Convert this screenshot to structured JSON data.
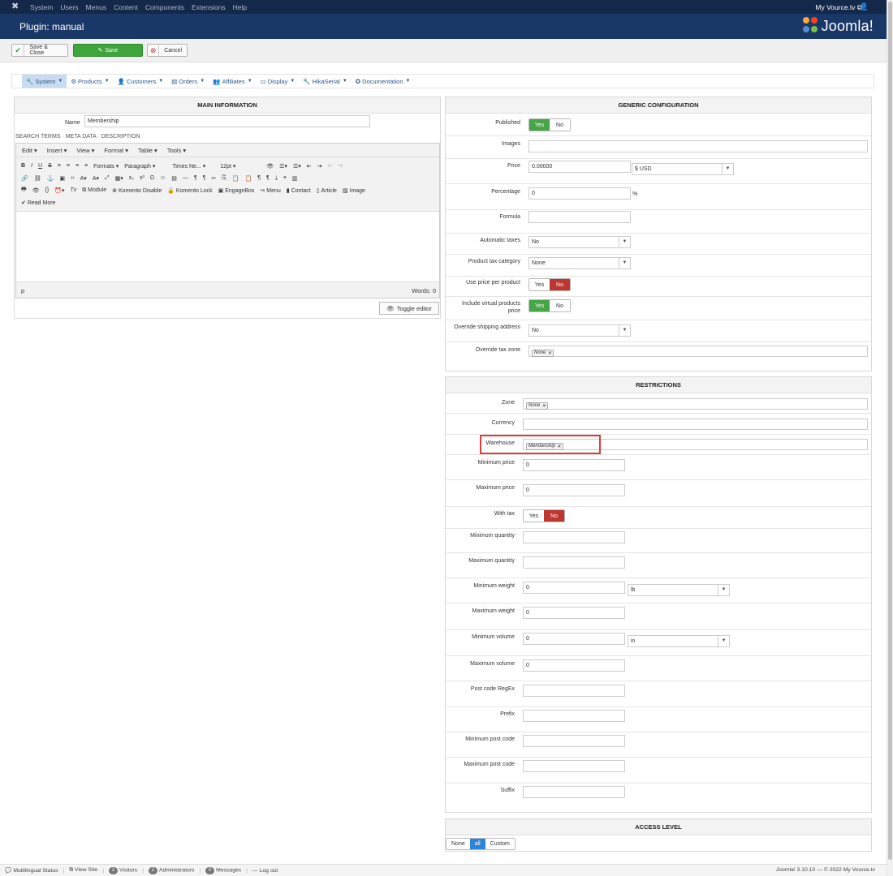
{
  "topbar": {
    "menu": [
      "System",
      "Users",
      "Menus",
      "Content",
      "Components",
      "Extensions",
      "Help"
    ],
    "site_link": "My Vource.tv"
  },
  "header": {
    "title": "Plugin: manual",
    "brand": "Joomla!"
  },
  "toolbar": {
    "save_close": "Save & Close",
    "save": "Save",
    "cancel": "Cancel"
  },
  "nav": [
    {
      "label": "System",
      "icon": "wrench-icon"
    },
    {
      "label": "Products",
      "icon": "products-icon"
    },
    {
      "label": "Customers",
      "icon": "user-icon"
    },
    {
      "label": "Orders",
      "icon": "orders-icon"
    },
    {
      "label": "Affiliates",
      "icon": "affiliates-icon"
    },
    {
      "label": "Display",
      "icon": "monitor-icon"
    },
    {
      "label": "HikaSerial",
      "icon": "wrench-icon"
    },
    {
      "label": "Documentation",
      "icon": "help-icon"
    }
  ],
  "main": {
    "header": "MAIN INFORMATION",
    "name_label": "Name",
    "name_value": "Membership",
    "subtabs": "SEARCH TERMS · META DATA · DESCRIPTION",
    "editor_menu": [
      "Edit",
      "Insert",
      "View",
      "Format",
      "Table",
      "Tools"
    ],
    "formats": "Formats",
    "paragraph": "Paragraph",
    "font": "Times Ne...",
    "size": "12pt",
    "buttons": [
      "Module",
      "Komento Disable",
      "Komento Lock",
      "EngageBox",
      "Menu",
      "Contact",
      "Article",
      "Image"
    ],
    "read_more": "Read More",
    "status_p": "p",
    "words": "Words: 0",
    "toggle": "Toggle editor"
  },
  "generic": {
    "header": "GENERIC CONFIGURATION",
    "published": "Published",
    "images": "Images",
    "price": "Price",
    "price_value": "0.00000",
    "currency_value": "$ USD",
    "percentage": "Percentage",
    "percentage_value": "0",
    "percent_sign": "%",
    "formula": "Formula",
    "auto_taxes": "Automatic taxes",
    "auto_taxes_value": "No",
    "tax_category": "Product tax category",
    "tax_category_value": "None",
    "use_price_per_product": "Use price per product",
    "include_virtual": "Include virtual products price",
    "override_shipping": "Override shipping address",
    "override_shipping_value": "No",
    "override_tax_zone": "Override tax zone",
    "tag_none": "None",
    "yes": "Yes",
    "no": "No"
  },
  "restrictions": {
    "header": "RESTRICTIONS",
    "zone": "Zone",
    "currency": "Currency",
    "warehouse": "Warehouse",
    "warehouse_tag": "Membership",
    "min_price": "Minimum price",
    "max_price": "Maximum price",
    "with_tax": "With tax",
    "min_qty": "Minimum quantity",
    "max_qty": "Maximum quantity",
    "min_weight": "Minimum weight",
    "max_weight": "Maximum weight",
    "weight_unit": "lb",
    "min_volume": "Minimum volume",
    "max_volume": "Maximum volume",
    "volume_unit": "in",
    "post_code_regex": "Post code RegEx",
    "prefix": "Prefix",
    "min_post_code": "Minimum post code",
    "max_post_code": "Maximum post code",
    "suffix": "Suffix",
    "zero": "0"
  },
  "access": {
    "header": "ACCESS LEVEL",
    "options": [
      "None",
      "all",
      "Custom"
    ]
  },
  "status": {
    "multilingual": "Multilingual Status",
    "view_site": "View Site",
    "visitors_count": "2",
    "visitors": "Visitors",
    "admins_count": "2",
    "admins": "Administrators",
    "messages_count": "0",
    "messages": "Messages",
    "logout": "Log out",
    "copyright": "Joomla! 3.10.10 — © 2022 My Vource.tv"
  },
  "colors": {
    "topbar": "#142849",
    "titlebar": "#1a3867",
    "save_green": "#3fa43b",
    "yes_green": "#46a546",
    "no_red": "#bd362f",
    "highlight": "#e03c3c",
    "nav_active": "#c8dbf1"
  }
}
